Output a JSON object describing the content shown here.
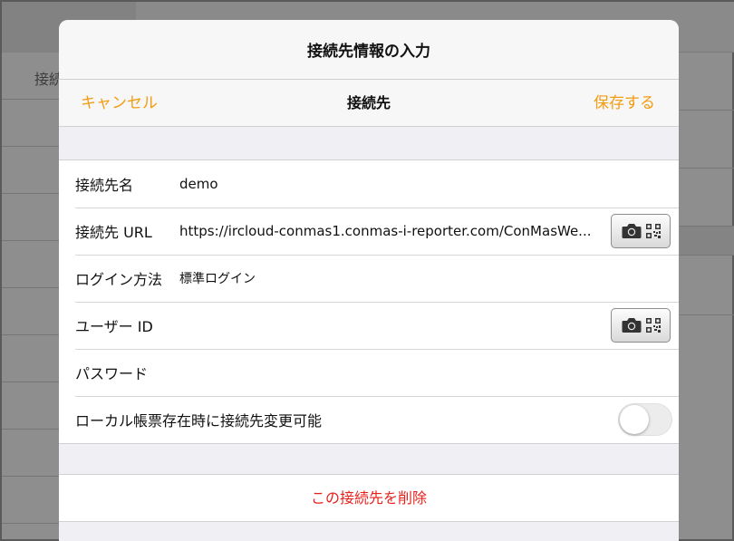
{
  "background": {
    "cell_text": "接続"
  },
  "sheet": {
    "title": "接続先情報の入力"
  },
  "nav": {
    "cancel_label": "キャンセル",
    "title": "接続先",
    "save_label": "保存する"
  },
  "form": {
    "rows": [
      {
        "label": "接続先名",
        "value": "demo"
      },
      {
        "label": "接続先 URL",
        "value": "https://ircloud-conmas1.conmas-i-reporter.com/ConMasWe..."
      },
      {
        "label": "ログイン方法",
        "value": "標準ログイン"
      },
      {
        "label": "ユーザー ID",
        "value": ""
      },
      {
        "label": "パスワード",
        "value": ""
      },
      {
        "label": "ローカル帳票存在時に接続先変更可能",
        "value": ""
      }
    ],
    "toggle_on": false
  },
  "delete": {
    "label": "この接続先を削除"
  },
  "colors": {
    "accent": "#f39c12",
    "destructive": "#e8201b"
  },
  "icons": [
    "camera-icon",
    "qr-code-icon"
  ]
}
